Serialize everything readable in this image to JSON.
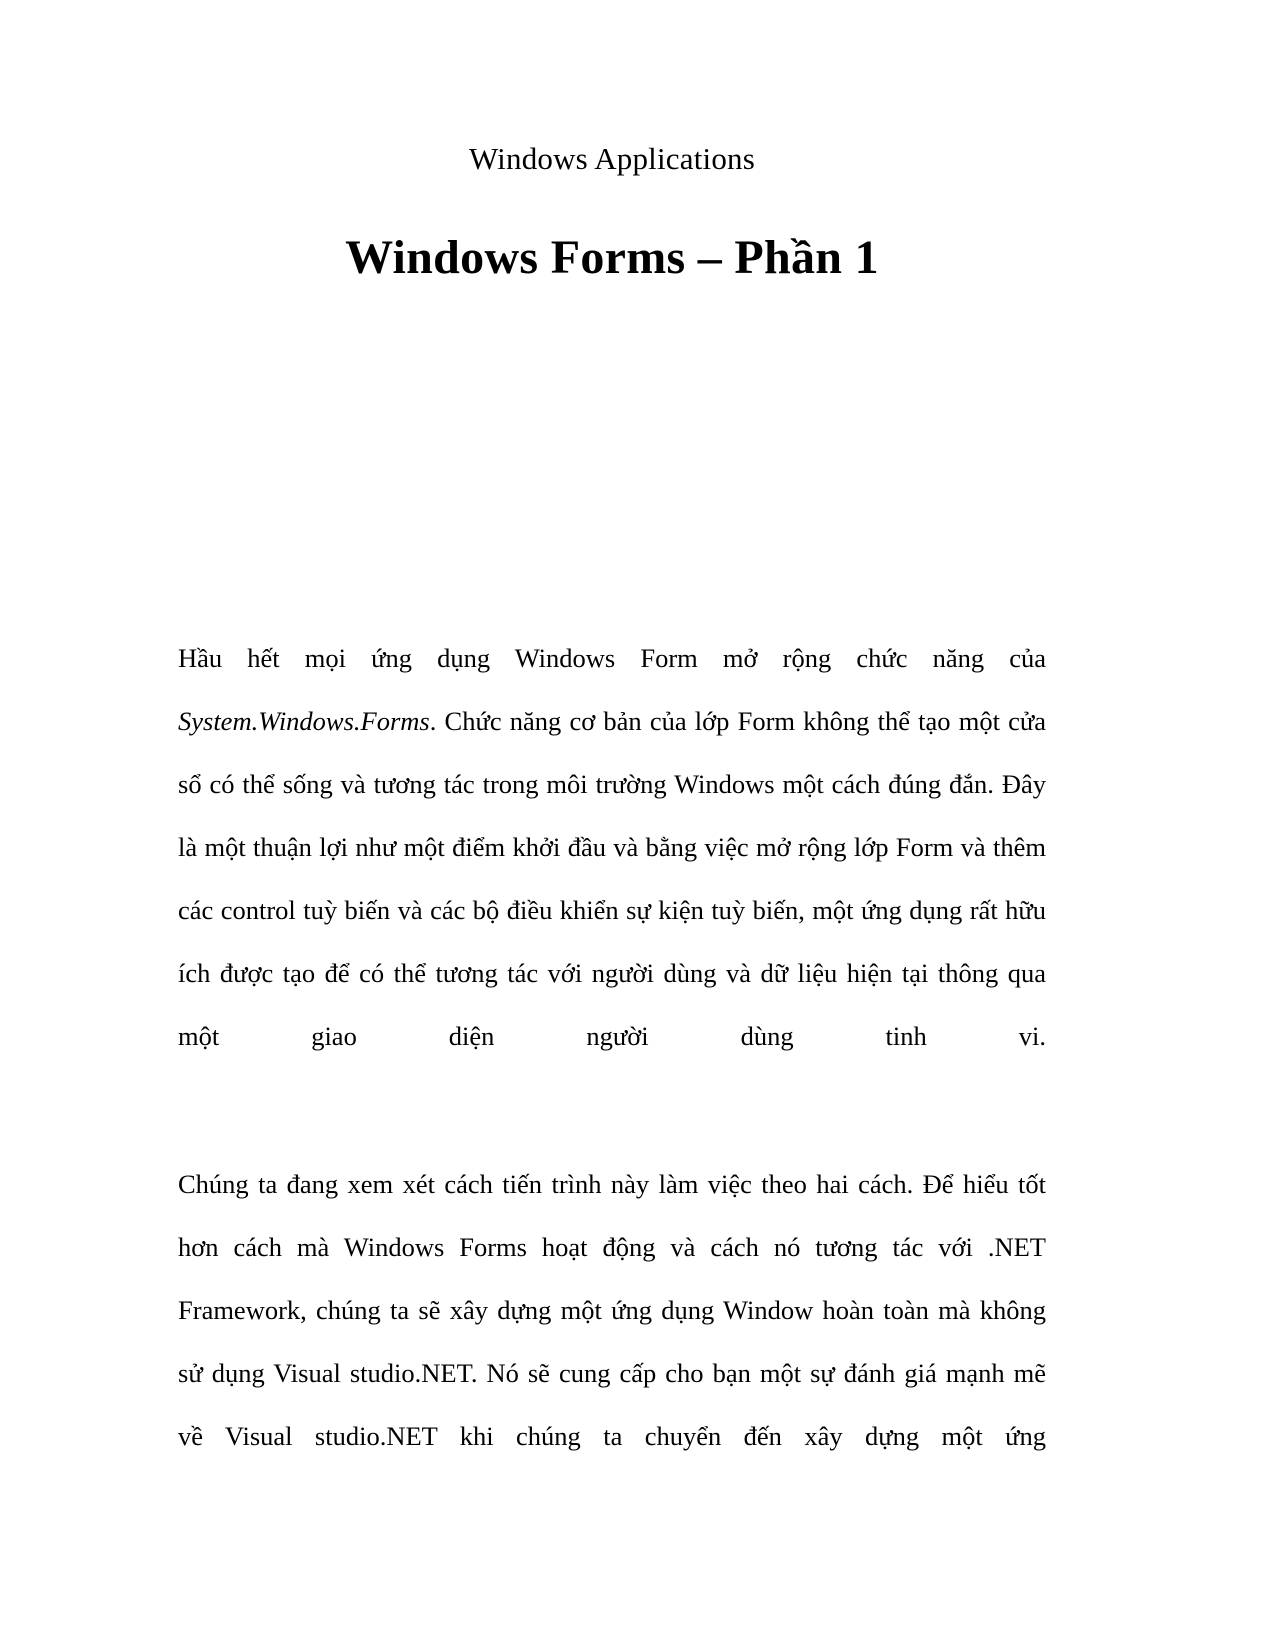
{
  "document": {
    "header": "Windows Applications",
    "title": "Windows Forms – Phần 1",
    "paragraphs": [
      {
        "id": "para-1",
        "runs": [
          {
            "style": "normal",
            "text": "Hầu hết mọi ứng dụng Windows Form mở rộng chức năng của "
          },
          {
            "style": "italic",
            "text": "System.Windows.Forms"
          },
          {
            "style": "normal",
            "text": ". Chức năng cơ bản của lớp Form không thể tạo một cửa sổ có thể sống và tương tác trong môi trường Windows một cách đúng đắn. Đây là một thuận lợi như một điểm khởi đầu và bằng việc mở rộng lớp Form và thêm các control tuỳ biến và các bộ điều khiển sự kiện tuỳ biến, một ứng dụng rất hữu ích được tạo để có thể tương tác với người dùng và dữ liệu hiện tại thông qua một giao diện người dùng tinh vi."
          }
        ]
      },
      {
        "id": "para-2",
        "runs": [
          {
            "style": "normal",
            "text": "Chúng ta đang xem xét cách tiến trình này làm việc theo hai cách. Để hiểu tốt hơn cách mà Windows Forms hoạt động và cách nó tương tác với .NET Framework, chúng ta sẽ xây dựng một ứng dụng Window hoàn toàn mà không sử dụng Visual studio.NET. Nó sẽ cung cấp cho bạn một sự đánh giá mạnh mẽ về Visual studio.NET khi chúng ta chuyển đến xây dựng một ứng"
          }
        ]
      }
    ]
  }
}
